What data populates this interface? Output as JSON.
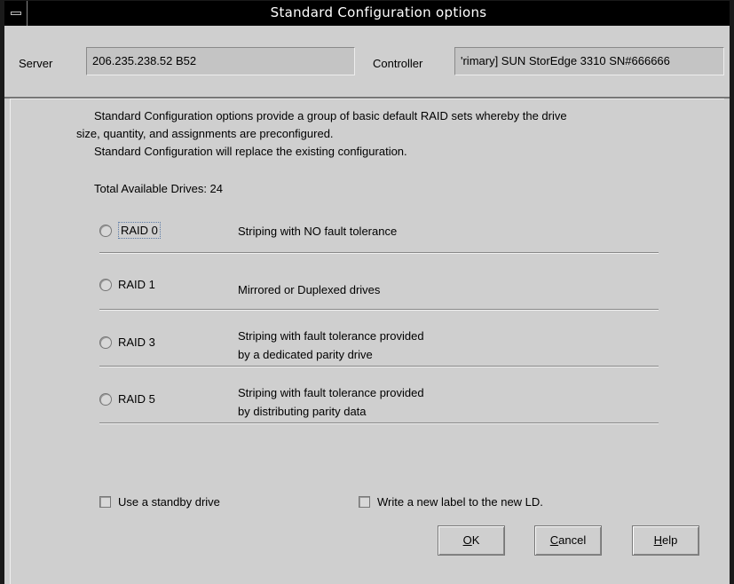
{
  "window": {
    "title": "Standard Configuration options"
  },
  "header": {
    "server_label": "Server",
    "server_value": "206.235.238.52 B52",
    "controller_label": "Controller",
    "controller_value": "'rimary] SUN StorEdge 3310 SN#666666"
  },
  "description": {
    "line1": "Standard Configuration options provide a group of basic default RAID sets whereby the drive",
    "line2": "size, quantity, and assignments are preconfigured.",
    "line3": "Standard Configuration will replace the existing configuration."
  },
  "drives": {
    "total_label": "Total Available Drives: 24"
  },
  "raid_options": [
    {
      "label": "RAID 0",
      "desc1": "Striping with NO fault tolerance",
      "desc2": "",
      "selected": false
    },
    {
      "label": "RAID 1",
      "desc1": "Mirrored or Duplexed drives",
      "desc2": "",
      "selected": false
    },
    {
      "label": "RAID 3",
      "desc1": "Striping with fault tolerance provided",
      "desc2": "by a dedicated parity drive",
      "selected": false
    },
    {
      "label": "RAID 5",
      "desc1": "Striping with fault tolerance provided",
      "desc2": "by distributing parity data",
      "selected": false
    }
  ],
  "options": {
    "standby_label": "Use a standby drive",
    "standby_checked": false,
    "new_label_label": "Write a new label to the new LD.",
    "new_label_checked": false
  },
  "buttons": {
    "ok_mnemonic": "O",
    "ok_rest": "K",
    "cancel_mnemonic": "C",
    "cancel_rest": "ancel",
    "help_mnemonic": "H",
    "help_rest": "elp"
  },
  "colors": {
    "titlebar": "#000000",
    "background": "#cfcfcf",
    "field": "#c4c4c4"
  }
}
